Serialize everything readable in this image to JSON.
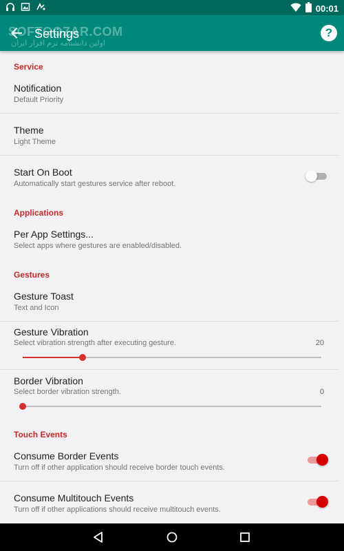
{
  "status_bar": {
    "time": "00:01",
    "left_icons": [
      "headphones-icon",
      "image-icon",
      "gesture-icon"
    ],
    "right_icons": [
      "wifi-icon",
      "battery-icon"
    ]
  },
  "app_bar": {
    "title": "Settings",
    "watermark": "SOFTGOZAR.COM",
    "watermark_sub": "اولین دانشنامه نرم افزار ایران",
    "back_icon": "arrow-back-icon",
    "help_icon": "help-icon",
    "help_glyph": "?"
  },
  "sections": {
    "service": {
      "header": "Service",
      "notification": {
        "title": "Notification",
        "subtitle": "Default Priority"
      },
      "theme": {
        "title": "Theme",
        "subtitle": "Light Theme"
      },
      "start_on_boot": {
        "title": "Start On Boot",
        "subtitle": "Automatically start gestures service after reboot.",
        "enabled": false
      }
    },
    "applications": {
      "header": "Applications",
      "per_app": {
        "title": "Per App Settings...",
        "subtitle": "Select apps where gestures are enabled/disabled."
      }
    },
    "gestures": {
      "header": "Gestures",
      "toast": {
        "title": "Gesture Toast",
        "subtitle": "Text and Icon"
      },
      "vibration": {
        "title": "Gesture Vibration",
        "subtitle": "Select vibration strength after executing gesture.",
        "value": "20",
        "fraction": 0.2
      },
      "border_vibration": {
        "title": "Border Vibration",
        "subtitle": "Select border vibration strength.",
        "value": "0",
        "fraction": 0
      }
    },
    "touch_events": {
      "header": "Touch Events",
      "consume_border": {
        "title": "Consume Border Events",
        "subtitle": "Turn off if other application should receive border touch events.",
        "enabled": true
      },
      "consume_multitouch": {
        "title": "Consume Multitouch Events",
        "subtitle": "Turn off if other applications should receive multitouch events.",
        "enabled": true
      }
    }
  },
  "colors": {
    "status_bar": "#00695c",
    "app_bar": "#00897b",
    "accent": "#d32f2f",
    "section_header": "#c62828",
    "background": "#f3f1f3"
  },
  "nav_bar": {
    "back_icon": "nav-back-icon",
    "home_icon": "nav-home-icon",
    "recents_icon": "nav-recents-icon"
  }
}
